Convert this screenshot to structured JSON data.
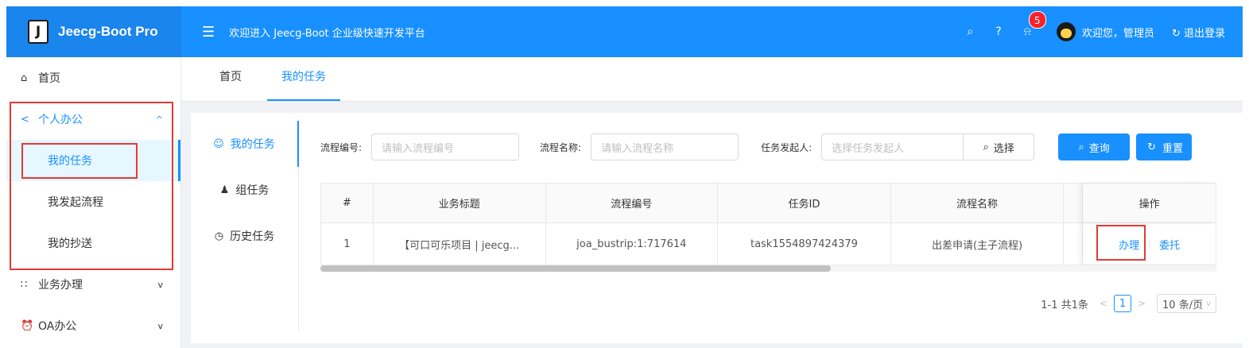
{
  "header": {
    "logo_letter": "J",
    "app_title": "Jeecg-Boot Pro",
    "welcome": "欢迎进入 Jeecg-Boot 企业级快速开发平台",
    "notification_count": "5",
    "user_greeting": "欢迎您，管理员",
    "logout_label": "退出登录"
  },
  "sidebar": {
    "items": [
      {
        "label": "首页",
        "icon": "home-icon"
      },
      {
        "label": "个人办公",
        "icon": "share-icon"
      },
      {
        "label": "业务办理",
        "icon": "org-icon"
      },
      {
        "label": "OA办公",
        "icon": "alarm-icon"
      }
    ],
    "sub_items": [
      {
        "label": "我的任务"
      },
      {
        "label": "我发起流程"
      },
      {
        "label": "我的抄送"
      }
    ]
  },
  "tabs": [
    {
      "label": "首页"
    },
    {
      "label": "我的任务"
    }
  ],
  "subnav": [
    {
      "label": "我的任务",
      "icon": "user-icon"
    },
    {
      "label": "组任务",
      "icon": "team-icon"
    },
    {
      "label": "历史任务",
      "icon": "clock-icon"
    }
  ],
  "search": {
    "process_no_label": "流程编号:",
    "process_no_placeholder": "请输入流程编号",
    "process_name_label": "流程名称:",
    "process_name_placeholder": "请输入流程名称",
    "initiator_label": "任务发起人:",
    "initiator_placeholder": "选择任务发起人",
    "select_label": "选择",
    "query_label": "查询",
    "reset_label": "重置"
  },
  "table": {
    "columns": [
      "#",
      "业务标题",
      "流程编号",
      "任务ID",
      "流程名称",
      "操作"
    ],
    "rows": [
      {
        "index": "1",
        "title": "【可口可乐项目 | jeecg...",
        "process_no": "joa_bustrip:1:717614",
        "task_id": "task1554897424379",
        "process_name": "出差申请(主子流程)",
        "op_handle": "办理",
        "op_delegate": "委托"
      }
    ]
  },
  "pagination": {
    "summary": "1-1 共1条",
    "current_page": "1",
    "page_size": "10 条/页"
  },
  "colors": {
    "primary": "#1890ff",
    "highlight_box": "#e53935"
  }
}
